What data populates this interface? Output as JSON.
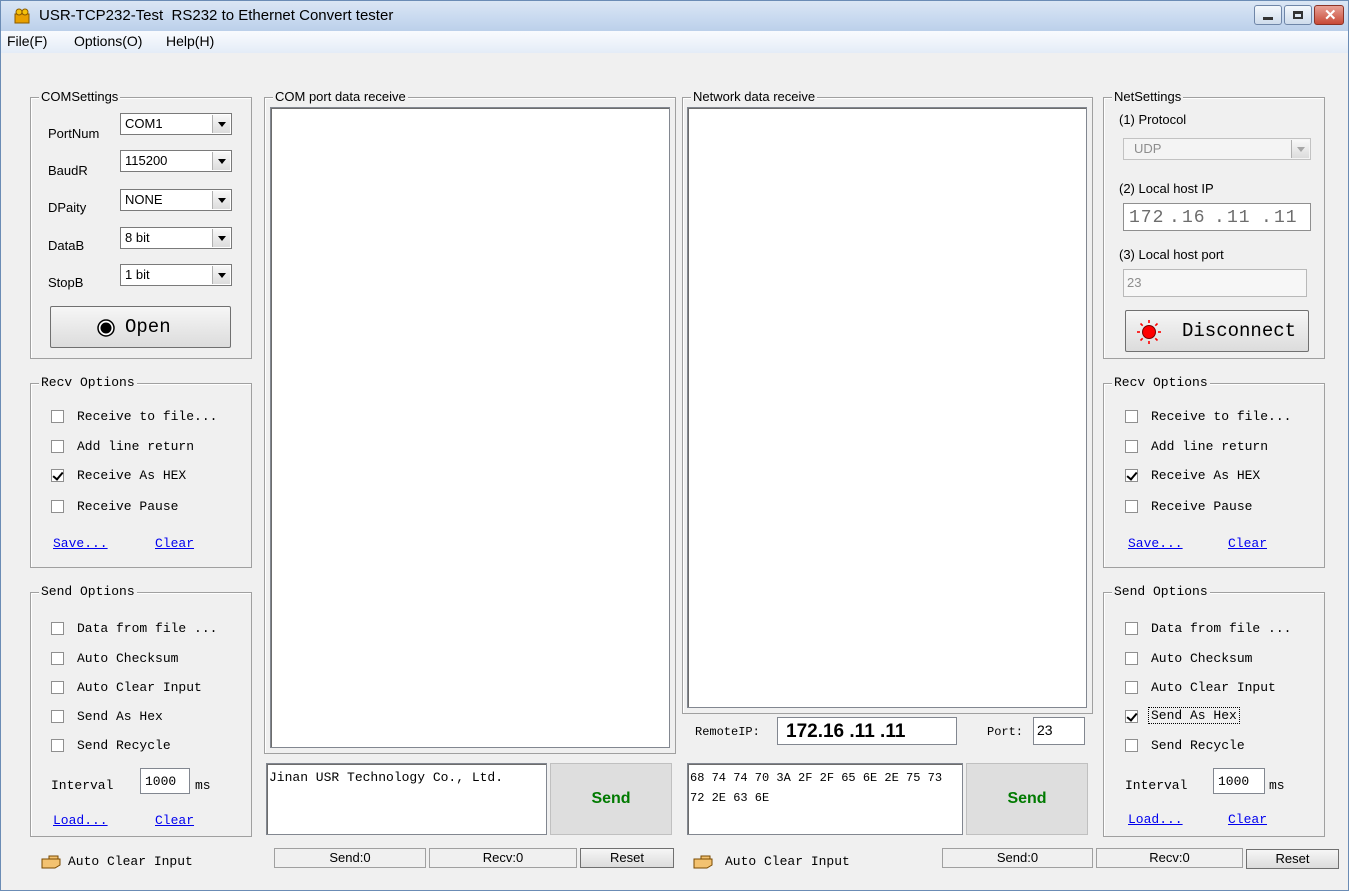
{
  "window": {
    "title": "USR-TCP232-Test  RS232 to Ethernet Convert tester",
    "menu": [
      "File(F)",
      "Options(O)",
      "Help(H)"
    ]
  },
  "com_settings": {
    "title": "COMSettings",
    "fields": [
      {
        "label": "PortNum",
        "value": "COM1"
      },
      {
        "label": "BaudR",
        "value": "115200"
      },
      {
        "label": "DPaity",
        "value": "NONE"
      },
      {
        "label": "DataB",
        "value": "8 bit"
      },
      {
        "label": "StopB",
        "value": "1 bit"
      }
    ],
    "open_label": "Open"
  },
  "left_recv": {
    "title": "Recv Options",
    "options": [
      {
        "label": "Receive to file...",
        "checked": false
      },
      {
        "label": "Add line return",
        "checked": false
      },
      {
        "label": "Receive As HEX",
        "checked": true
      },
      {
        "label": "Receive Pause",
        "checked": false
      }
    ],
    "save": "Save...",
    "clear": "Clear"
  },
  "left_send": {
    "title": "Send Options",
    "options": [
      {
        "label": "Data from file ...",
        "checked": false
      },
      {
        "label": "Auto Checksum",
        "checked": false
      },
      {
        "label": "Auto Clear Input",
        "checked": false
      },
      {
        "label": "Send As Hex",
        "checked": false
      },
      {
        "label": "Send Recycle",
        "checked": false
      }
    ],
    "interval_label": "Interval",
    "interval_value": "1000",
    "interval_unit": "ms",
    "load": "Load...",
    "clear": "Clear"
  },
  "com_receive": {
    "title": "COM port data receive"
  },
  "com_send": {
    "text": "Jinan USR Technology Co., Ltd.",
    "send_label": "Send"
  },
  "net_receive": {
    "title": "Network data receive"
  },
  "remote": {
    "ip_label": "RemoteIP:",
    "ip_value": "172.16 .11 .11",
    "port_label": "Port:",
    "port_value": "23"
  },
  "net_send": {
    "text": "68 74 74 70 3A 2F 2F 65 6E 2E 75 73 72 2E 63 6E",
    "send_label": "Send"
  },
  "net_settings": {
    "title": "NetSettings",
    "protocol_label": "(1) Protocol",
    "protocol_value": "UDP",
    "local_ip_label": "(2) Local host IP",
    "local_ip_parts": [
      "172",
      "16",
      "11",
      "11"
    ],
    "local_port_label": "(3) Local host port",
    "local_port_value": "23",
    "disconnect_label": "Disconnect"
  },
  "right_recv": {
    "title": "Recv Options",
    "options": [
      {
        "label": "Receive to file...",
        "checked": false
      },
      {
        "label": "Add line return",
        "checked": false
      },
      {
        "label": "Receive As HEX",
        "checked": true
      },
      {
        "label": "Receive Pause",
        "checked": false
      }
    ],
    "save": "Save...",
    "clear": "Clear"
  },
  "right_send": {
    "title": "Send Options",
    "options": [
      {
        "label": "Data from file ...",
        "checked": false
      },
      {
        "label": "Auto Checksum",
        "checked": false
      },
      {
        "label": "Auto Clear Input",
        "checked": false
      },
      {
        "label": "Send As Hex",
        "checked": true
      },
      {
        "label": "Send Recycle",
        "checked": false
      }
    ],
    "interval_label": "Interval",
    "interval_value": "1000",
    "interval_unit": "ms",
    "load": "Load...",
    "clear": "Clear"
  },
  "status": {
    "left_auto_clear": "Auto Clear Input",
    "left_send": "Send:0",
    "left_recv": "Recv:0",
    "left_reset": "Reset",
    "right_auto_clear": "Auto Clear Input",
    "right_send": "Send:0",
    "right_recv": "Recv:0",
    "right_reset": "Reset"
  },
  "colors": {
    "send_text": "#007a00",
    "link": "#0000ee",
    "indicator_red": "#ff0000"
  }
}
